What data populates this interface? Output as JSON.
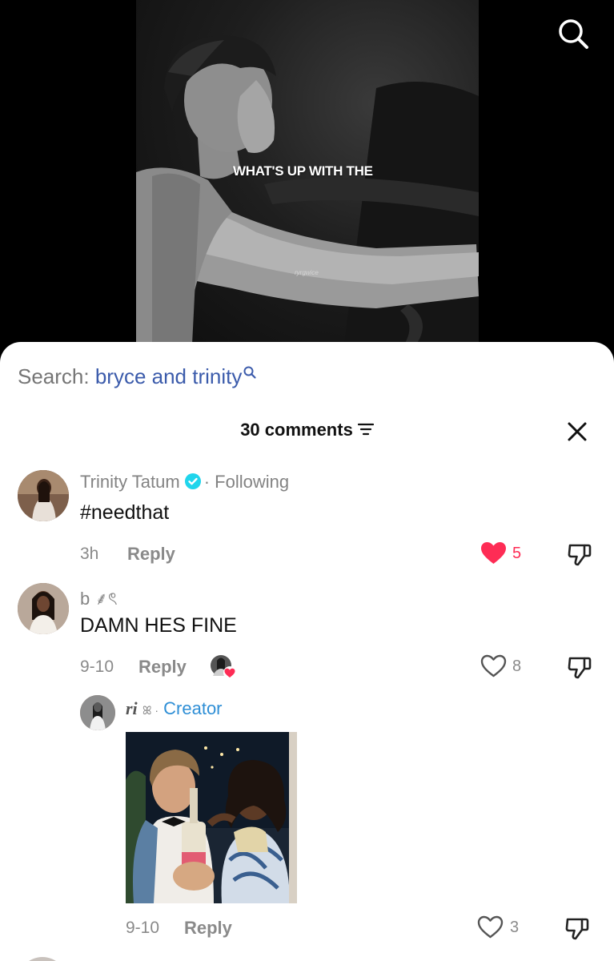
{
  "video": {
    "overlay_text": "WHAT'S UP WITH THE",
    "watermark": "ryrgwice"
  },
  "search": {
    "prefix": "Search: ",
    "query": "bryce and trinity"
  },
  "comments_header": {
    "count_label": "30 comments"
  },
  "comments": [
    {
      "name": "Trinity Tatum",
      "suffix": "· Following",
      "text": "#needthat",
      "time": "3h",
      "reply_label": "Reply",
      "likes": "5"
    },
    {
      "name": "b ⸙ৎ",
      "text": "DAMN HES FINE",
      "time": "9-10",
      "reply_label": "Reply",
      "likes": "8"
    }
  ],
  "reply": {
    "name": "ri",
    "name_suffix": "ꕤ ·",
    "badge": "Creator",
    "time": "9-10",
    "reply_label": "Reply",
    "likes": "3"
  },
  "colors": {
    "like_red": "#fe2c55",
    "search_query": "#3b5bab",
    "creator_blue": "#2f8fd6",
    "verified_blue": "#20d5ec"
  }
}
